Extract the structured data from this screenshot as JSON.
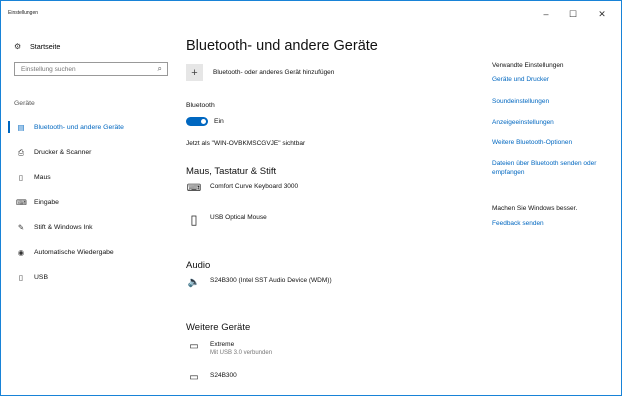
{
  "window": {
    "title": "Einstellungen",
    "min": "–",
    "max": "☐",
    "close": "✕"
  },
  "sidebar": {
    "home_label": "Startseite",
    "home_icon": "gear-icon",
    "search_placeholder": "Einstellung suchen",
    "section_label": "Geräte",
    "items": [
      {
        "label": "Bluetooth- und andere Geräte",
        "icon": "devices-icon",
        "active": true
      },
      {
        "label": "Drucker & Scanner",
        "icon": "printer-icon",
        "active": false
      },
      {
        "label": "Maus",
        "icon": "mouse-icon",
        "active": false
      },
      {
        "label": "Eingabe",
        "icon": "keyboard-icon",
        "active": false
      },
      {
        "label": "Stift & Windows Ink",
        "icon": "pen-icon",
        "active": false
      },
      {
        "label": "Automatische Wiedergabe",
        "icon": "autoplay-icon",
        "active": false
      },
      {
        "label": "USB",
        "icon": "usb-icon",
        "active": false
      }
    ]
  },
  "main": {
    "title": "Bluetooth- und andere Geräte",
    "add_device_label": "Bluetooth- oder anderes Gerät hinzufügen",
    "bluetooth_label": "Bluetooth",
    "bluetooth_state": "Ein",
    "visible_as": "Jetzt als \"WIN-OVBKMSCGVJE\" sichtbar",
    "sections": {
      "mouse_keyboard": {
        "heading": "Maus, Tastatur & Stift",
        "devices": [
          {
            "name": "Comfort Curve Keyboard 3000",
            "icon": "keyboard-icon"
          },
          {
            "name": "USB Optical Mouse",
            "icon": "mouse-icon"
          }
        ]
      },
      "audio": {
        "heading": "Audio",
        "devices": [
          {
            "name": "S24B300 (Intel SST Audio Device (WDM))",
            "icon": "speaker-icon"
          }
        ]
      },
      "other": {
        "heading": "Weitere Geräte",
        "devices": [
          {
            "name": "Extreme",
            "sub": "Mit USB 3.0 verbunden",
            "icon": "drive-icon"
          },
          {
            "name": "S24B300",
            "icon": "monitor-icon"
          }
        ]
      }
    }
  },
  "related": {
    "heading": "Verwandte Einstellungen",
    "links": [
      "Geräte und Drucker",
      "Soundeinstellungen",
      "Anzeigeeinstellungen",
      "Weitere Bluetooth-Optionen",
      "Dateien über Bluetooth senden oder empfangen"
    ],
    "feedback_heading": "Machen Sie Windows besser.",
    "feedback_link": "Feedback senden"
  }
}
